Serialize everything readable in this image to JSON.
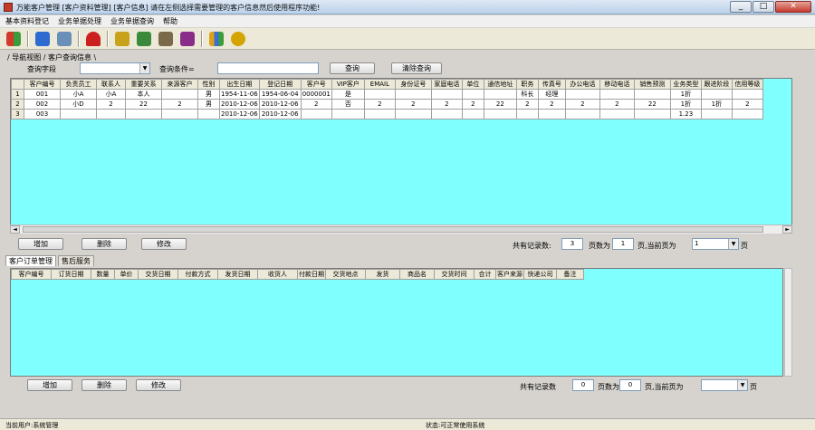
{
  "window": {
    "title": "万能客户管理 [客户资料管理] [客户信息] 请在左侧选择需要管理的客户信息然后使用程序功能!",
    "controls": [
      "_",
      "□",
      "✕"
    ]
  },
  "menu": [
    "基本资料登记",
    "业务单据处理",
    "业务单据查询",
    "帮助"
  ],
  "toolbar": {
    "icons": [
      {
        "name": "people-transfer-icon",
        "color": "#d23a2b"
      },
      {
        "name": "notebook-icon",
        "color": "#2d6bd0"
      },
      {
        "name": "scroll-icon",
        "color": "#6a8fb8"
      },
      {
        "name": "umbrella-icon",
        "color": "#cc1f1f"
      },
      {
        "name": "clock-icon",
        "color": "#c7a21a"
      },
      {
        "name": "picture-icon",
        "color": "#3b8a3b"
      },
      {
        "name": "book-icon",
        "color": "#7b6a4a"
      },
      {
        "name": "books-icon",
        "color": "#8a2d8a"
      },
      {
        "name": "gift-icon",
        "color": "#e0a116"
      },
      {
        "name": "runner-icon",
        "color": "#d4a500"
      }
    ]
  },
  "breadcrumb": "/ 导航视图 / 客户查询信息 \\",
  "filter": {
    "field_label": "查询字段",
    "field_value": "",
    "keyword_label": "查询条件=",
    "keyword_value": "",
    "query_button": "查询",
    "clear_button": "清除查询"
  },
  "customers": {
    "columns": [
      "客户编号",
      "负责员工",
      "联系人",
      "重要关系",
      "来源客户",
      "性别",
      "出生日期",
      "登记日期",
      "客户号",
      "VIP客户",
      "EMAIL",
      "身份证号",
      "家庭电话",
      "单位",
      "通信地址",
      "职务",
      "传真号",
      "办公电话",
      "移动电话",
      "销售预测",
      "业务类型",
      "跟进阶段",
      "信用等级"
    ],
    "rows": [
      [
        "001",
        "小A",
        "小A",
        "本人",
        "",
        "男",
        "1954-11-06",
        "1954-06-04",
        "0000001",
        "是",
        "",
        "",
        "",
        "",
        "",
        "科长",
        "经理",
        "",
        "",
        "",
        "1折",
        "",
        ""
      ],
      [
        "002",
        "小D",
        "2",
        "22",
        "2",
        "男",
        "2010-12-06",
        "2010-12-06",
        "2",
        "否",
        "2",
        "2",
        "2",
        "2",
        "22",
        "2",
        "2",
        "2",
        "2",
        "22",
        "1折",
        "1折",
        "2"
      ],
      [
        "003",
        "",
        "",
        "",
        "",
        "",
        "2010-12-06",
        "2010-12-06",
        "",
        "",
        "",
        "",
        "",
        "",
        "",
        "",
        "",
        "",
        "",
        "",
        "1.23",
        "",
        ""
      ]
    ],
    "row_numbers": [
      "1",
      "2",
      "3"
    ]
  },
  "grid1_actions": {
    "add": "增加",
    "delete": "删除",
    "edit": "修改"
  },
  "paging1": {
    "total_label": "共有记录数:",
    "total": "3",
    "pages_label": "页数为",
    "pages": "1",
    "page_label": "页,当前页为",
    "current": "1",
    "suffix": "页"
  },
  "tabs": [
    "客户订单管理",
    "售后服务"
  ],
  "orders": {
    "columns": [
      "客户编号",
      "订货日期",
      "数量",
      "单价",
      "交货日期",
      "付款方式",
      "发货日期",
      "收货人",
      "付款日期",
      "交货地点",
      "发货",
      "商品名",
      "交货时间",
      "合计",
      "客户来源",
      "快递公司",
      "备注"
    ]
  },
  "grid2_actions": {
    "add": "增加",
    "delete": "删除",
    "edit": "修改"
  },
  "paging2": {
    "total_label": "共有记录数",
    "total": "0",
    "pages_label": "页数为",
    "pages": "0",
    "page_label": "页,当前页为",
    "current": "",
    "suffix": "页"
  },
  "status": {
    "left": "当前用户:系统管理",
    "center": "状态:可正常使用系统"
  }
}
